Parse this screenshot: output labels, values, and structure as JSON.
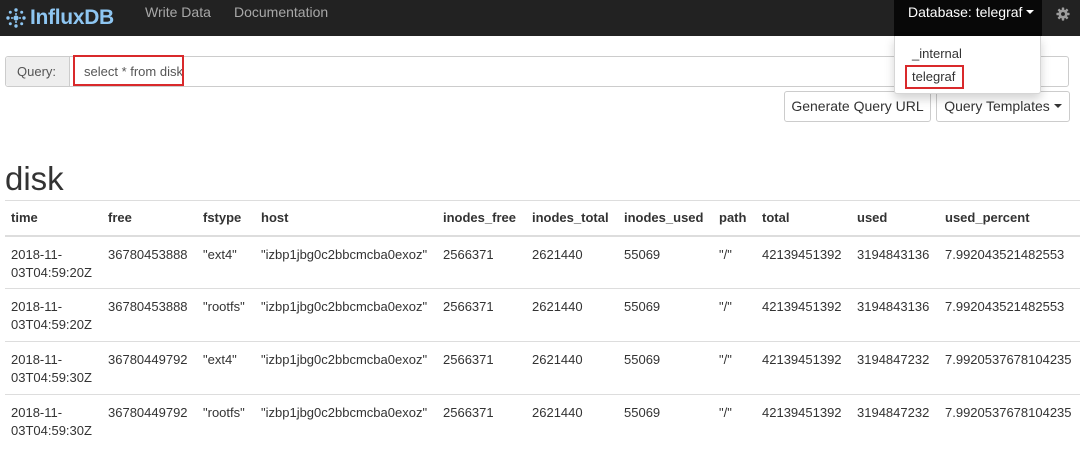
{
  "navbar": {
    "brand": "InfluxDB",
    "links": [
      "Write Data",
      "Documentation"
    ],
    "database_label": "Database: telegraf",
    "settings_icon": "gear-icon"
  },
  "database_dropdown": {
    "items": [
      "_internal",
      "telegraf"
    ],
    "selected": "telegraf"
  },
  "query": {
    "label": "Query:",
    "value": "select * from disk"
  },
  "actions": {
    "generate_url": "Generate Query URL",
    "templates": "Query Templates"
  },
  "results": {
    "measurement": "disk",
    "columns": [
      "time",
      "free",
      "fstype",
      "host",
      "inodes_free",
      "inodes_total",
      "inodes_used",
      "path",
      "total",
      "used",
      "used_percent"
    ],
    "rows": [
      [
        "2018-11-03T04:59:20Z",
        "36780453888",
        "\"ext4\"",
        "\"izbp1jbg0c2bbcmcba0exoz\"",
        "2566371",
        "2621440",
        "55069",
        "\"/\"",
        "42139451392",
        "3194843136",
        "7.992043521482553"
      ],
      [
        "2018-11-03T04:59:20Z",
        "36780453888",
        "\"rootfs\"",
        "\"izbp1jbg0c2bbcmcba0exoz\"",
        "2566371",
        "2621440",
        "55069",
        "\"/\"",
        "42139451392",
        "3194843136",
        "7.992043521482553"
      ],
      [
        "2018-11-03T04:59:30Z",
        "36780449792",
        "\"ext4\"",
        "\"izbp1jbg0c2bbcmcba0exoz\"",
        "2566371",
        "2621440",
        "55069",
        "\"/\"",
        "42139451392",
        "3194847232",
        "7.9920537678104235"
      ],
      [
        "2018-11-03T04:59:30Z",
        "36780449792",
        "\"rootfs\"",
        "\"izbp1jbg0c2bbcmcba0exoz\"",
        "2566371",
        "2621440",
        "55069",
        "\"/\"",
        "42139451392",
        "3194847232",
        "7.9920537678104235"
      ]
    ]
  },
  "colors": {
    "navbar_bg": "#222222",
    "brand": "#8ec6f2",
    "annotation_highlight": "#d9292b"
  }
}
